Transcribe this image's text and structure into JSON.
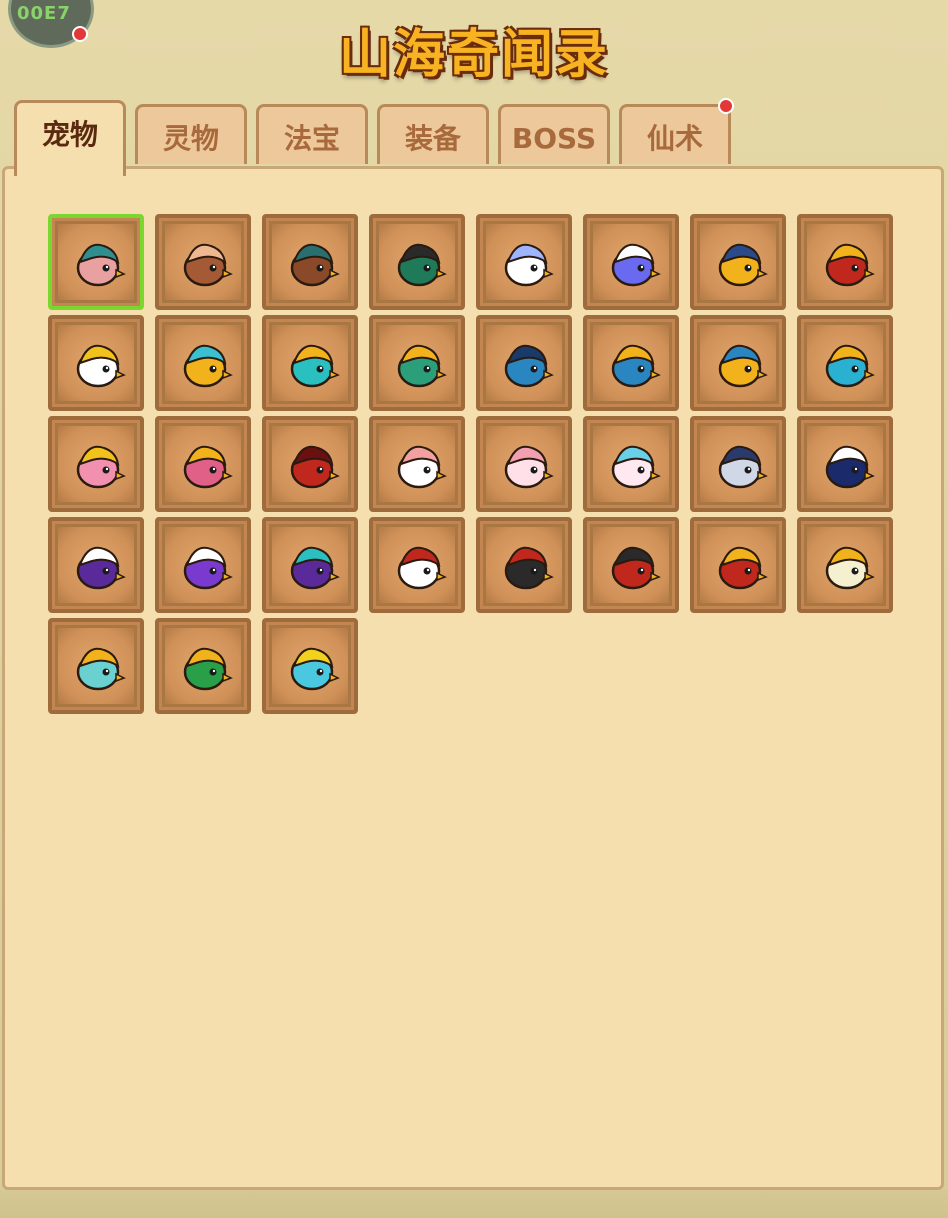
{
  "header": {
    "title": "山海奇闻录",
    "avatar_text": "00E7"
  },
  "tabs": [
    {
      "label": "宠物",
      "active": true,
      "badge": false
    },
    {
      "label": "灵物",
      "active": false,
      "badge": false
    },
    {
      "label": "法宝",
      "active": false,
      "badge": false
    },
    {
      "label": "装备",
      "active": false,
      "badge": false
    },
    {
      "label": "BOSS",
      "active": false,
      "badge": false
    },
    {
      "label": "仙术",
      "active": false,
      "badge": true
    }
  ],
  "colors": {
    "title": "#f7b322",
    "panel": "#f5dfae",
    "slot_border": "#9e6b3c",
    "selected_border": "#7bd62f",
    "badge": "#e33838"
  },
  "pets": [
    {
      "icon": "teal-monkey-icon",
      "selected": true
    },
    {
      "icon": "brown-monkey-icon",
      "selected": false
    },
    {
      "icon": "striped-monkey-icon",
      "selected": false
    },
    {
      "icon": "green-leaf-monkey-icon",
      "selected": false
    },
    {
      "icon": "white-ram-icon",
      "selected": false
    },
    {
      "icon": "blue-unicorn-icon",
      "selected": false
    },
    {
      "icon": "golden-helmet-icon",
      "selected": false
    },
    {
      "icon": "red-armor-horn-icon",
      "selected": false
    },
    {
      "icon": "white-gold-ram-icon",
      "selected": false
    },
    {
      "icon": "gold-cyan-ram-icon",
      "selected": false
    },
    {
      "icon": "teal-armor-ram-icon",
      "selected": false
    },
    {
      "icon": "jade-armor-beast-icon",
      "selected": false
    },
    {
      "icon": "blue-helmet-icon",
      "selected": false
    },
    {
      "icon": "green-helmet-icon",
      "selected": false
    },
    {
      "icon": "gold-horn-helmet-icon",
      "selected": false
    },
    {
      "icon": "cyan-dragon-armor-icon",
      "selected": false
    },
    {
      "icon": "pink-bird-icon",
      "selected": false
    },
    {
      "icon": "pink-crest-bird-icon",
      "selected": false
    },
    {
      "icon": "red-phoenix-icon",
      "selected": false
    },
    {
      "icon": "white-rabbit-icon",
      "selected": false
    },
    {
      "icon": "pink-rabbit-icon",
      "selected": false
    },
    {
      "icon": "crystal-rabbit-icon",
      "selected": false
    },
    {
      "icon": "silver-mecha-rabbit-icon",
      "selected": false
    },
    {
      "icon": "navy-helmet-icon",
      "selected": false
    },
    {
      "icon": "purple-helmet-icon",
      "selected": false
    },
    {
      "icon": "purple-horn-beast-icon",
      "selected": false
    },
    {
      "icon": "purple-dragon-icon",
      "selected": false
    },
    {
      "icon": "white-red-beast-icon",
      "selected": false
    },
    {
      "icon": "black-red-beast-icon",
      "selected": false
    },
    {
      "icon": "red-horn-beast-icon",
      "selected": false
    },
    {
      "icon": "demon-horn-beast-icon",
      "selected": false
    },
    {
      "icon": "cream-chick-icon",
      "selected": false
    },
    {
      "icon": "teal-parrot-icon",
      "selected": false
    },
    {
      "icon": "green-parrot-icon",
      "selected": false
    },
    {
      "icon": "cyan-mane-bird-icon",
      "selected": false
    }
  ]
}
